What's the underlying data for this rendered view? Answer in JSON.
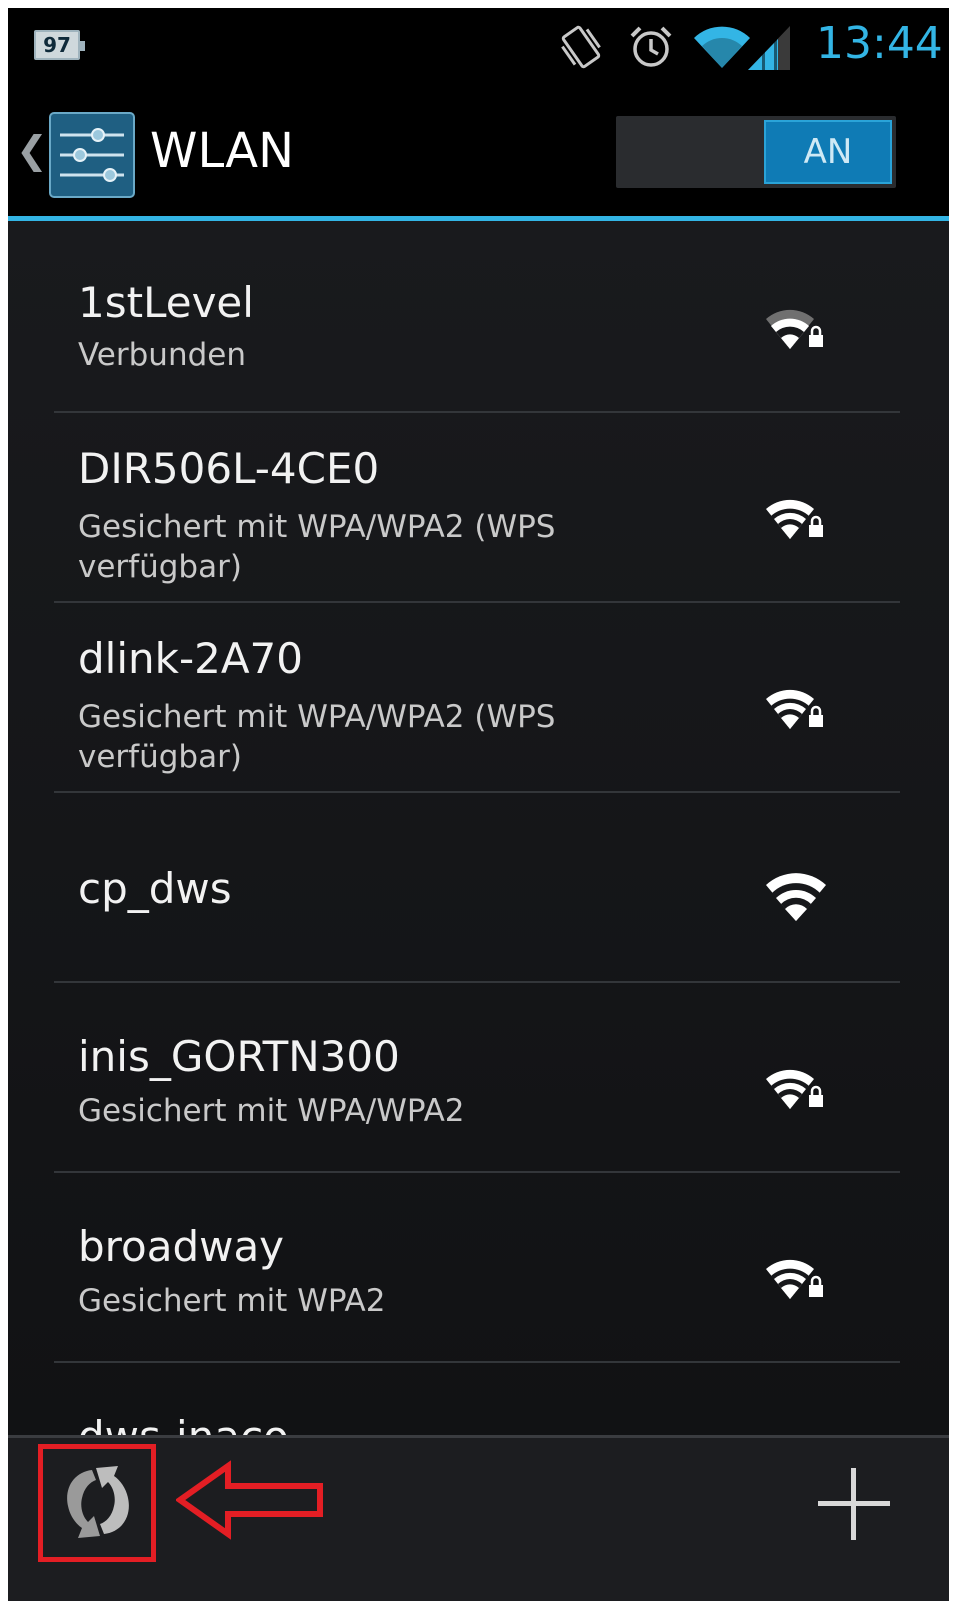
{
  "status_bar": {
    "battery_level": "97",
    "time": "13:44",
    "icons": [
      "vibrate-icon",
      "alarm-icon",
      "wifi-signal-icon",
      "cell-signal-icon"
    ]
  },
  "action_bar": {
    "title": "WLAN",
    "toggle_label": "AN",
    "accent_color": "#33b5e5"
  },
  "networks": [
    {
      "ssid": "1stLevel",
      "status": "Verbunden",
      "secured": true,
      "signal": "strong"
    },
    {
      "ssid": "DIR506L-4CE0",
      "status": "Gesichert mit WPA/WPA2 (WPS verfügbar)",
      "secured": true,
      "signal": "full"
    },
    {
      "ssid": "dlink-2A70",
      "status": "Gesichert mit WPA/WPA2 (WPS verfügbar)",
      "secured": true,
      "signal": "full"
    },
    {
      "ssid": "cp_dws",
      "status": "",
      "secured": false,
      "signal": "full"
    },
    {
      "ssid": "inis_GORTN300",
      "status": "Gesichert mit WPA/WPA2",
      "secured": true,
      "signal": "full"
    },
    {
      "ssid": "broadway",
      "status": "Gesichert mit WPA2",
      "secured": true,
      "signal": "full"
    },
    {
      "ssid": "dws-inaco",
      "status": "",
      "secured": false,
      "signal": "full"
    }
  ],
  "bottom_bar": {
    "scan_icon": "refresh-scan-icon",
    "add_icon": "plus-icon",
    "highlight_color": "#e31e24"
  }
}
